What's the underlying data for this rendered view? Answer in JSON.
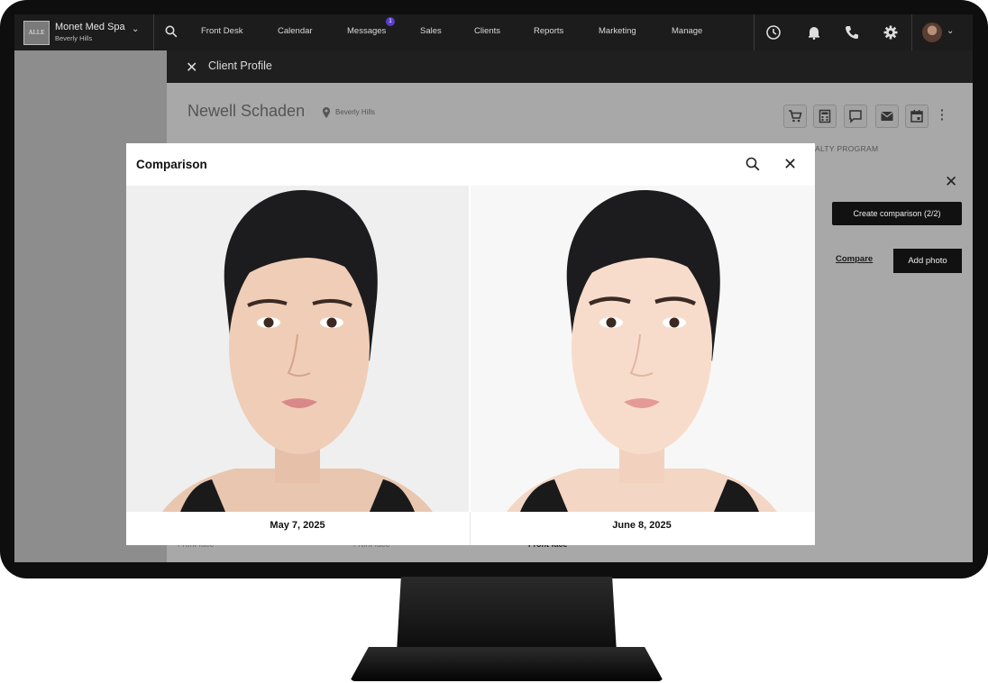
{
  "app": {
    "brand_name": "Monet Med Spa",
    "brand_location": "Beverly Hills",
    "logo_text": "ALLE",
    "nav": [
      "Front Desk",
      "Calendar",
      "Messages",
      "Sales",
      "Clients",
      "Reports",
      "Marketing",
      "Manage"
    ],
    "messages_badge": "1",
    "right_icons": [
      "clock-icon",
      "bell-icon",
      "phone-icon",
      "gear-icon"
    ]
  },
  "subheader": {
    "title": "Client Profile"
  },
  "client": {
    "name": "Newell Schaden",
    "location": "Beverly Hills",
    "action_icons": [
      "cart-icon",
      "calculator-icon",
      "chat-icon",
      "mail-icon",
      "calendar-icon"
    ],
    "tab_partial": "ALTY PROGRAM"
  },
  "panel": {
    "create_comparison": "Create comparison (2/2)",
    "compare_link": "Compare",
    "add_photo": "Add photo",
    "photo_labels": [
      "Front face",
      "Front face",
      "Front face"
    ]
  },
  "modal": {
    "title": "Comparison",
    "photos": [
      {
        "date": "May 7, 2025"
      },
      {
        "date": "June 8, 2025"
      }
    ]
  },
  "colors": {
    "accent_badge": "#5a3ec8",
    "nav_bg": "#1c1c1c",
    "modal_bg": "#ffffff"
  }
}
